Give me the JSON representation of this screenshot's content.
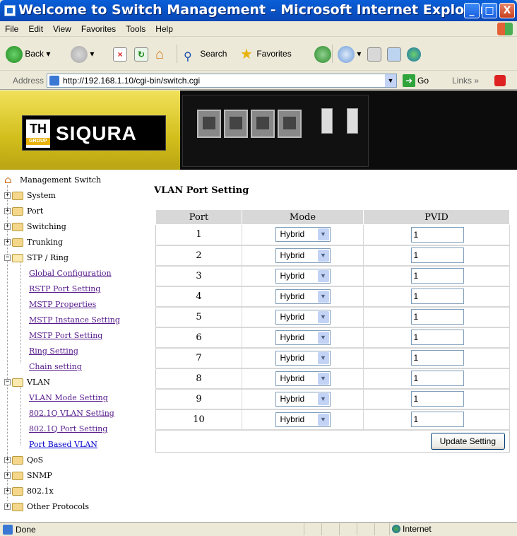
{
  "window": {
    "title": "Welcome to Switch Management - Microsoft Internet Explorer",
    "minimize_label": "_",
    "maximize_label": "□",
    "close_label": "X"
  },
  "menu": [
    "File",
    "Edit",
    "View",
    "Favorites",
    "Tools",
    "Help"
  ],
  "toolbar": {
    "back_label": "Back",
    "search_label": "Search",
    "favorites_label": "Favorites"
  },
  "address": {
    "label": "Address",
    "url": "http://192.168.1.10/cgi-bin/switch.cgi",
    "go_label": "Go",
    "links_label": "Links"
  },
  "banner": {
    "logo_th": "TH",
    "logo_group": "GROUP",
    "logo_brand": "SIQURA"
  },
  "tree": {
    "root": "Management Switch",
    "items": [
      {
        "label": "System"
      },
      {
        "label": "Port"
      },
      {
        "label": "Switching"
      },
      {
        "label": "Trunking"
      },
      {
        "label": "STP / Ring"
      },
      {
        "label": "Global Configuration"
      },
      {
        "label": "RSTP Port Setting"
      },
      {
        "label": "MSTP Properties"
      },
      {
        "label": "MSTP Instance Setting"
      },
      {
        "label": "MSTP Port Setting"
      },
      {
        "label": "Ring Setting"
      },
      {
        "label": "Chain setting"
      },
      {
        "label": "VLAN"
      },
      {
        "label": "VLAN Mode Setting"
      },
      {
        "label": "802.1Q VLAN Setting"
      },
      {
        "label": "802.1Q Port Setting"
      },
      {
        "label": "Port Based VLAN"
      },
      {
        "label": "QoS"
      },
      {
        "label": "SNMP"
      },
      {
        "label": "802.1x"
      },
      {
        "label": "Other Protocols"
      }
    ]
  },
  "main": {
    "title": "VLAN Port Setting",
    "columns": [
      "Port",
      "Mode",
      "PVID"
    ],
    "rows": [
      {
        "port": "1",
        "mode": "Hybrid",
        "pvid": "1"
      },
      {
        "port": "2",
        "mode": "Hybrid",
        "pvid": "1"
      },
      {
        "port": "3",
        "mode": "Hybrid",
        "pvid": "1"
      },
      {
        "port": "4",
        "mode": "Hybrid",
        "pvid": "1"
      },
      {
        "port": "5",
        "mode": "Hybrid",
        "pvid": "1"
      },
      {
        "port": "6",
        "mode": "Hybrid",
        "pvid": "1"
      },
      {
        "port": "7",
        "mode": "Hybrid",
        "pvid": "1"
      },
      {
        "port": "8",
        "mode": "Hybrid",
        "pvid": "1"
      },
      {
        "port": "9",
        "mode": "Hybrid",
        "pvid": "1"
      },
      {
        "port": "10",
        "mode": "Hybrid",
        "pvid": "1"
      }
    ],
    "update_button": "Update Setting"
  },
  "status": {
    "text": "Done",
    "zone": "Internet"
  },
  "colors": {
    "titlebar": "#0854C8",
    "chrome": "#ECE9D8",
    "banner_gold": "#D2BE1C",
    "table_header": "#D8D8D8",
    "visited_link": "#551A8B"
  },
  "icons": [
    "ie-page-icon",
    "back-icon",
    "forward-icon",
    "stop-icon",
    "refresh-icon",
    "home-icon",
    "search-icon",
    "favorites-icon",
    "history-icon",
    "mail-icon",
    "print-icon",
    "edit-icon",
    "messenger-icon",
    "go-icon",
    "globe-icon",
    "folder-icon",
    "house-icon"
  ]
}
